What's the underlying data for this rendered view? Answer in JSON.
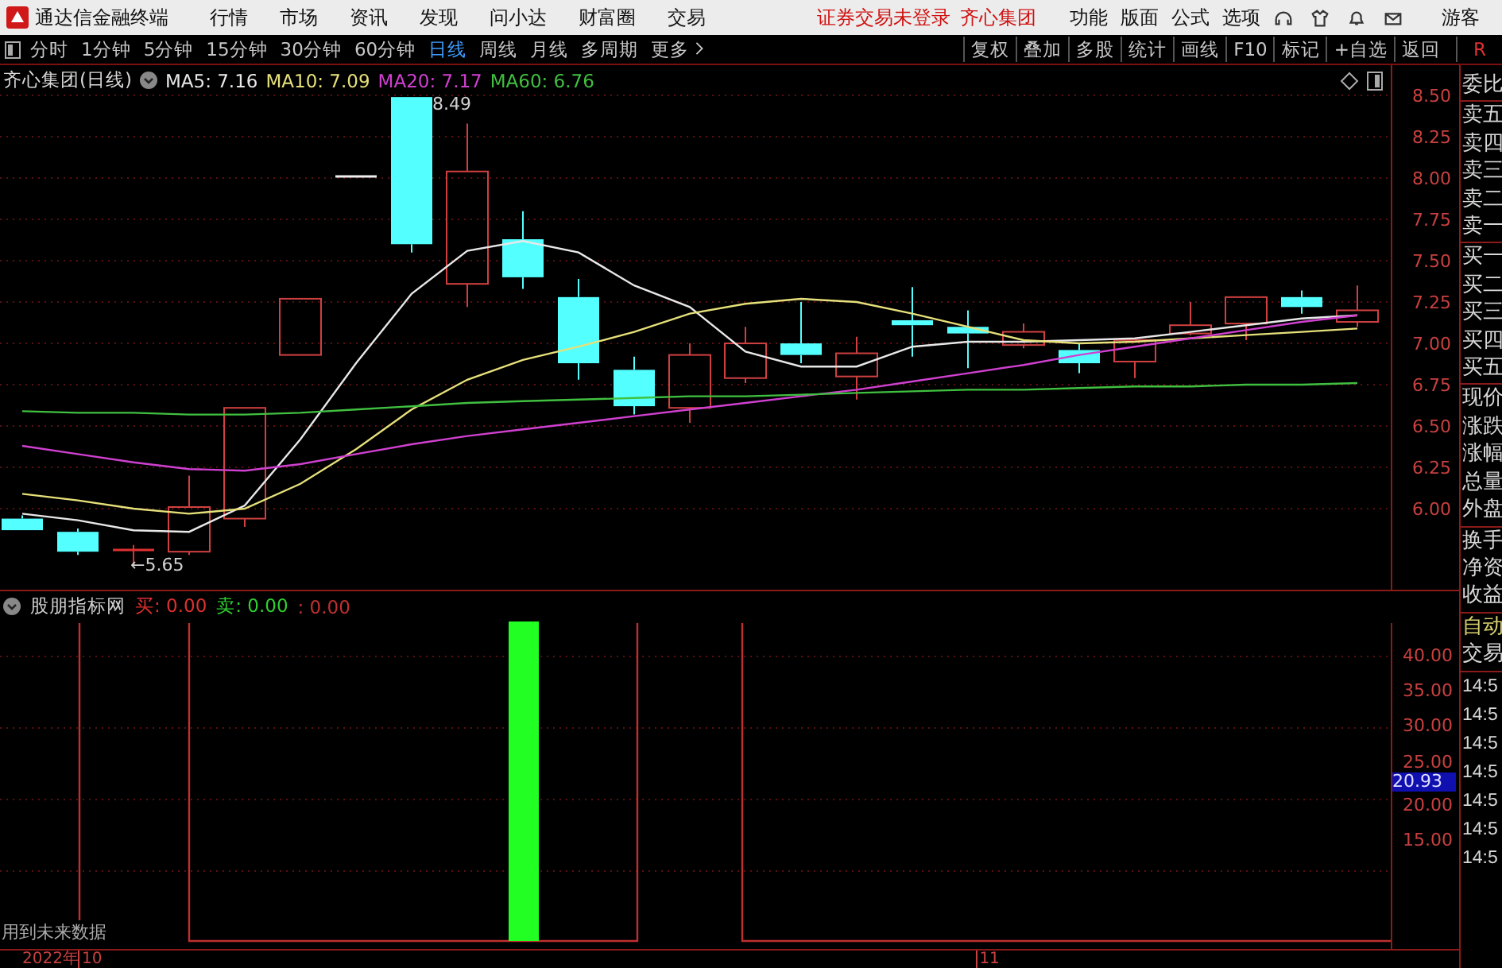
{
  "top_bar": {
    "app_title": "通达信金融终端",
    "menu": [
      "行情",
      "市场",
      "资讯",
      "发现",
      "问小达",
      "财富圈",
      "交易"
    ],
    "notice": "证券交易未登录",
    "stock": "齐心集团",
    "tools": [
      "功能",
      "版面",
      "公式",
      "选项"
    ],
    "user": "游客"
  },
  "period_bar": {
    "periods": [
      {
        "label": "分时",
        "selected": false
      },
      {
        "label": "1分钟",
        "selected": false
      },
      {
        "label": "5分钟",
        "selected": false
      },
      {
        "label": "15分钟",
        "selected": false
      },
      {
        "label": "30分钟",
        "selected": false
      },
      {
        "label": "60分钟",
        "selected": false
      },
      {
        "label": "日线",
        "selected": true
      },
      {
        "label": "周线",
        "selected": false
      },
      {
        "label": "月线",
        "selected": false
      },
      {
        "label": "多周期",
        "selected": false
      }
    ],
    "more": "更多",
    "actions": [
      "复权",
      "叠加",
      "多股",
      "统计",
      "画线",
      "F10",
      "标记",
      "+自选",
      "返回"
    ],
    "corner": "R"
  },
  "price_chart": {
    "title": "齐心集团(日线)",
    "legend": [
      ": 7.16",
      ": 7.09",
      ": 7.17",
      ": 6.76"
    ],
    "high_label": "8.49",
    "low_label": "←5.65",
    "chart_data": {
      "type": "line",
      "grid": true,
      "ylim": [
        5.51,
        8.683
      ],
      "yticks": [
        {
          "value": 6,
          "label": "6.00"
        },
        {
          "value": 6.25,
          "label": "6.25"
        },
        {
          "value": 6.5,
          "label": "6.50"
        },
        {
          "value": 6.75,
          "label": "6.75"
        },
        {
          "value": 7,
          "label": "7.00"
        },
        {
          "value": 7.25,
          "label": "7.25"
        },
        {
          "value": 7.5,
          "label": "7.50"
        },
        {
          "value": 7.75,
          "label": "7.75"
        },
        {
          "value": 8,
          "label": "8.00"
        },
        {
          "value": 8.25,
          "label": "8.25"
        },
        {
          "value": 8.5,
          "label": "8.50"
        }
      ],
      "series": [
        {
          "name": "MA5",
          "color": "#e8e8e8",
          "values": [
            5.97,
            5.93,
            5.87,
            5.86,
            6.02,
            6.42,
            6.88,
            7.3,
            7.56,
            7.62,
            7.55,
            7.35,
            7.22,
            6.95,
            6.86,
            6.86,
            6.98,
            7.01,
            7.01,
            7.02,
            7.03,
            7.07,
            7.11,
            7.15,
            7.17
          ]
        },
        {
          "name": "MA10",
          "color": "#e6e07a",
          "values": [
            6.09,
            6.05,
            6.0,
            5.97,
            6.0,
            6.15,
            6.36,
            6.6,
            6.78,
            6.9,
            6.98,
            7.07,
            7.18,
            7.24,
            7.27,
            7.25,
            7.18,
            7.1,
            7.02,
            7.0,
            7.01,
            7.03,
            7.05,
            7.07,
            7.09
          ]
        },
        {
          "name": "MA20",
          "color": "#d040d0",
          "values": [
            6.38,
            6.33,
            6.28,
            6.24,
            6.23,
            6.27,
            6.33,
            6.39,
            6.44,
            6.48,
            6.52,
            6.56,
            6.6,
            6.64,
            6.68,
            6.72,
            6.77,
            6.82,
            6.87,
            6.93,
            6.98,
            7.03,
            7.08,
            7.13,
            7.17
          ]
        },
        {
          "name": "MA60",
          "color": "#40c040",
          "values": [
            6.59,
            6.58,
            6.58,
            6.57,
            6.57,
            6.58,
            6.6,
            6.62,
            6.64,
            6.65,
            6.66,
            6.67,
            6.68,
            6.68,
            6.69,
            6.7,
            6.71,
            6.72,
            6.72,
            6.73,
            6.74,
            6.74,
            6.75,
            6.75,
            6.76
          ]
        }
      ]
    }
  },
  "indicator": {
    "title": "股朋指标网",
    "readouts": [
      {
        "text": "买: 0.00",
        "color": "#e03030"
      },
      {
        "text": "卖: 0.00",
        "color": "#30d030"
      },
      {
        "text": ": 0.00",
        "color": "#c03030"
      }
    ],
    "axis_labels": [
      "40.00",
      "35.00",
      "30.00",
      "25.00",
      "20.00",
      "15.00"
    ],
    "cursor_value": "20.93",
    "note": "用到未来数据"
  },
  "date_axis": {
    "year": "2022年",
    "labels": [
      "10",
      "11"
    ]
  },
  "side_panel": {
    "groups": [
      {
        "items": [
          {
            "text": "委比",
            "kind": "field"
          }
        ]
      },
      {
        "items": [
          {
            "text": "卖五",
            "kind": "field"
          },
          {
            "text": "卖四",
            "kind": "field"
          },
          {
            "text": "卖三",
            "kind": "field"
          },
          {
            "text": "卖二",
            "kind": "field"
          },
          {
            "text": "卖一",
            "kind": "field"
          }
        ]
      },
      {
        "items": [
          {
            "text": "买一",
            "kind": "field"
          },
          {
            "text": "买二",
            "kind": "field"
          },
          {
            "text": "买三",
            "kind": "field"
          },
          {
            "text": "买四",
            "kind": "field"
          },
          {
            "text": "买五",
            "kind": "field"
          }
        ]
      },
      {
        "items": [
          {
            "text": "现价",
            "kind": "field"
          },
          {
            "text": "涨跌",
            "kind": "field"
          },
          {
            "text": "涨幅",
            "kind": "field"
          },
          {
            "text": "总量",
            "kind": "field"
          },
          {
            "text": "外盘",
            "kind": "field"
          }
        ]
      },
      {
        "items": [
          {
            "text": "换手",
            "kind": "field"
          },
          {
            "text": "净资",
            "kind": "field"
          },
          {
            "text": "收益",
            "kind": "field"
          }
        ]
      },
      {
        "items": [
          {
            "text": "自动",
            "kind": "action"
          },
          {
            "text": "交易",
            "kind": "field"
          }
        ]
      },
      {
        "items": [
          {
            "text": "14:5",
            "kind": "time"
          },
          {
            "text": "14:5",
            "kind": "time"
          },
          {
            "text": "14:5",
            "kind": "time"
          },
          {
            "text": "14:5",
            "kind": "time"
          },
          {
            "text": "14:5",
            "kind": "time"
          },
          {
            "text": "14:5",
            "kind": "time"
          },
          {
            "text": "14:5",
            "kind": "time"
          }
        ]
      }
    ]
  }
}
